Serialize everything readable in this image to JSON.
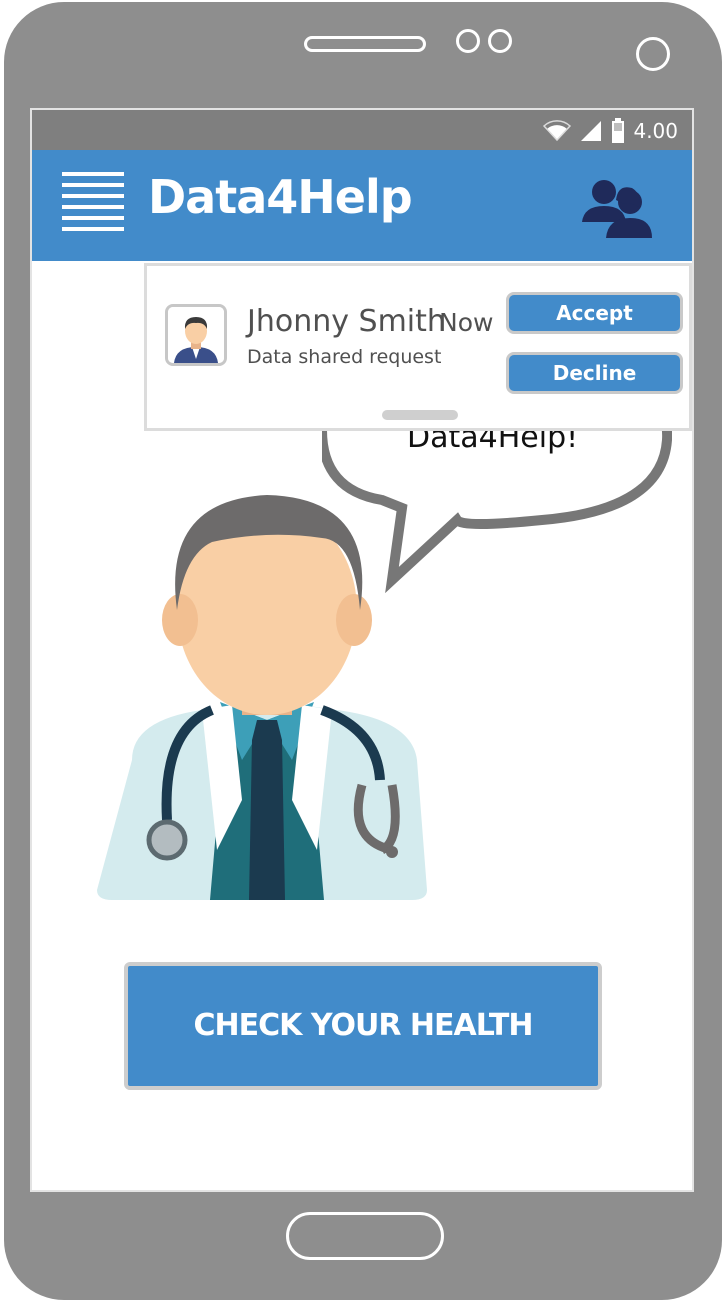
{
  "status_bar": {
    "time": "4.00",
    "icons": [
      "wifi-icon",
      "signal-icon",
      "battery-icon"
    ]
  },
  "app_bar": {
    "title": "Data4Help",
    "menu_icon": "hamburger-menu-icon",
    "action_icon": "users-icon"
  },
  "notification": {
    "sender": "Jhonny Smith",
    "time": "Now",
    "message": "Data shared request",
    "accept_label": "Accept",
    "decline_label": "Decline"
  },
  "speech_bubble": {
    "text": "Data4Help!"
  },
  "main": {
    "cta_label": "CHECK YOUR HEALTH"
  },
  "colors": {
    "primary": "#428bca",
    "frame": "#8e8e8e",
    "status_bar": "#7f7f7f",
    "icon_navy": "#1f2a5a"
  }
}
